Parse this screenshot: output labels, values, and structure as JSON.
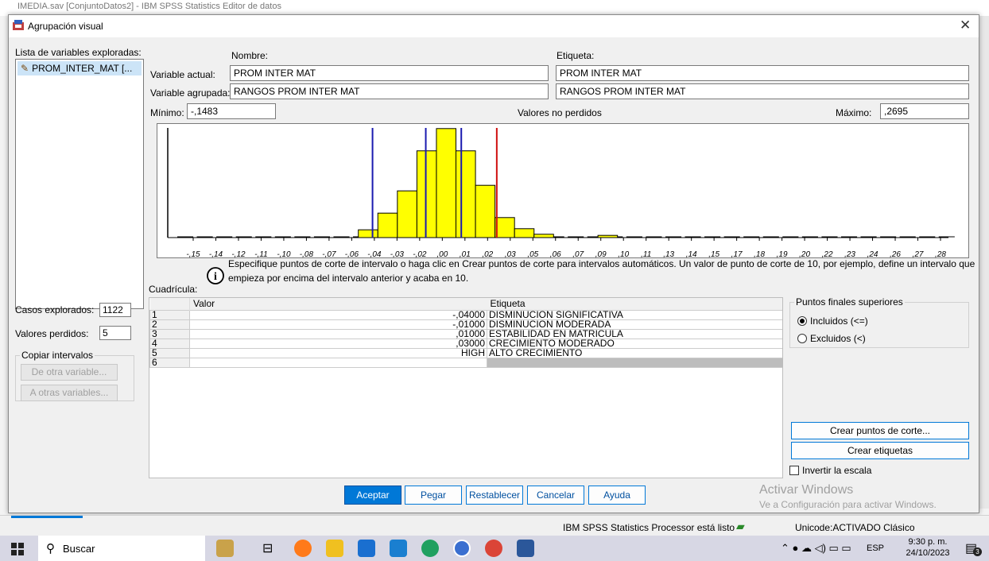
{
  "background_window": {
    "title": "IMEDIA.sav [ConjuntoDatos2] - IBM SPSS Statistics Editor de datos"
  },
  "dialog": {
    "title": "Agrupación visual",
    "variables_list_label": "Lista de variables exploradas:",
    "variables": [
      "PROM_INTER_MAT [..."
    ],
    "col_nombre": "Nombre:",
    "col_etiqueta": "Etiqueta:",
    "variable_actual_label": "Variable actual:",
    "variable_actual_nombre": "PROM  INTER  MAT",
    "variable_actual_etiqueta": "PROM  INTER  MAT",
    "variable_agrupada_label": "Variable agrupada:",
    "variable_agrupada_nombre": "RANGOS  PROM  INTER  MAT",
    "variable_agrupada_etiqueta": "RANGOS  PROM  INTER  MAT",
    "minimo_label": "Mínimo:",
    "minimo_value": "-,1483",
    "valores_no_perdidos": "Valores no perdidos",
    "maximo_label": "Máximo:",
    "maximo_value": ",2695",
    "info_text": "Especifique puntos de corte de intervalo o haga clic en Crear puntos de corte para intervalos automáticos. Un valor de punto de corte de 10, por ejemplo, define un intervalo que empieza por encima del intervalo anterior y acaba en 10.",
    "casos_explorados_label": "Casos explorados:",
    "casos_explorados_value": "1122",
    "valores_perdidos_label": "Valores perdidos:",
    "valores_perdidos_value": "5",
    "copiar_intervalos": "Copiar intervalos",
    "de_otra_variable": "De otra variable...",
    "a_otras_variables": "A otras variables...",
    "cuadricula_label": "Cuadrícula:",
    "grid_header_valor": "Valor",
    "grid_header_etiqueta": "Etiqueta",
    "grid_rows": [
      {
        "n": "1",
        "valor": "-,04000",
        "etiqueta": "DISMINUCION SIGNIFICATIVA"
      },
      {
        "n": "2",
        "valor": "-,01000",
        "etiqueta": "DISMINUCION MODERADA"
      },
      {
        "n": "3",
        "valor": ",01000",
        "etiqueta": "ESTABILIDAD EN MATRICULA"
      },
      {
        "n": "4",
        "valor": ",03000",
        "etiqueta": "CRECIMIENTO MODERADO"
      },
      {
        "n": "5",
        "valor": "HIGH",
        "etiqueta": "ALTO CRECIMIENTO"
      },
      {
        "n": "6",
        "valor": "",
        "etiqueta": ""
      }
    ],
    "puntos_finales_label": "Puntos finales superiores",
    "incluidos": "Incluidos (<=)",
    "excluidos": "Excluidos (<)",
    "crear_puntos": "Crear puntos de corte...",
    "crear_etiquetas": "Crear etiquetas",
    "invertir_escala": "Invertir la escala",
    "buttons": {
      "aceptar": "Aceptar",
      "pegar": "Pegar",
      "restablecer": "Restablecer",
      "cancelar": "Cancelar",
      "ayuda": "Ayuda"
    }
  },
  "watermark": {
    "line1": "Activar Windows",
    "line2": "Ve a Configuración para activar Windows."
  },
  "status": {
    "processor": "IBM SPSS Statistics Processor está listo",
    "unicode": "Unicode:ACTIVADO  Clásico"
  },
  "taskbar": {
    "search": "Buscar",
    "lang": "ESP",
    "time": "9:30 p. m.",
    "date": "24/10/2023",
    "notif_count": "3"
  },
  "chart_data": {
    "type": "bar",
    "title": "",
    "xlabel": "",
    "ylabel": "",
    "x_ticks": [
      "-,15",
      "-,14",
      "-,12",
      "-,11",
      "-,10",
      "-,08",
      "-,07",
      "-,06",
      "-,04",
      "-,03",
      "-,02",
      ",00",
      ",01",
      ",02",
      ",03",
      ",05",
      ",06",
      ",07",
      ",09",
      ",10",
      ",11",
      ",13",
      ",14",
      ",15",
      ",17",
      ",18",
      ",19",
      ",20",
      ",22",
      ",23",
      ",24",
      ",26",
      ",27",
      ",28"
    ],
    "bins": [
      {
        "x0": -0.048,
        "x1": -0.037,
        "height": 0.07
      },
      {
        "x0": -0.037,
        "x1": -0.026,
        "height": 0.22
      },
      {
        "x0": -0.026,
        "x1": -0.015,
        "height": 0.42
      },
      {
        "x0": -0.015,
        "x1": -0.004,
        "height": 0.78
      },
      {
        "x0": -0.004,
        "x1": 0.007,
        "height": 0.98
      },
      {
        "x0": 0.007,
        "x1": 0.018,
        "height": 0.78
      },
      {
        "x0": 0.018,
        "x1": 0.029,
        "height": 0.47
      },
      {
        "x0": 0.029,
        "x1": 0.04,
        "height": 0.18
      },
      {
        "x0": 0.04,
        "x1": 0.051,
        "height": 0.08
      },
      {
        "x0": 0.051,
        "x1": 0.062,
        "height": 0.03
      },
      {
        "x0": 0.087,
        "x1": 0.098,
        "height": 0.02
      }
    ],
    "xlim": [
      -0.1483,
      0.2695
    ],
    "cutpoints": [
      {
        "value": -0.04,
        "color": "#1a1ab0"
      },
      {
        "value": -0.01,
        "color": "#1a1ab0"
      },
      {
        "value": 0.01,
        "color": "#1a1ab0"
      },
      {
        "value": 0.03,
        "color": "#d01010"
      }
    ],
    "bar_color": "#ffff00"
  }
}
